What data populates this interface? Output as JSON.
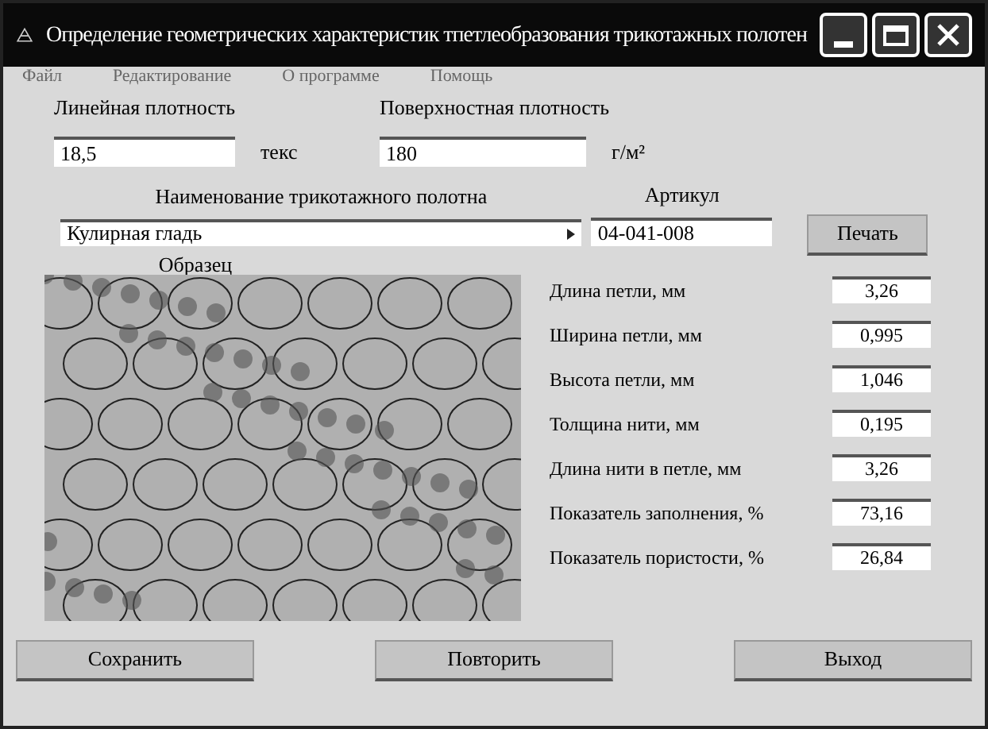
{
  "window": {
    "title": "Определение геометрических характеристик тпетлеобразования трикотажных полотен"
  },
  "menu": [
    "Файл",
    "Редактирование",
    "О программе",
    "Помощь"
  ],
  "linear_density": {
    "label": "Линейная  плотность",
    "value": "18,5",
    "unit": "текс"
  },
  "surface_density": {
    "label": "Поверхностная плотность",
    "value": "180",
    "unit": "г/м²"
  },
  "fabric_name": {
    "label": "Наименование трикотажного полотна",
    "value": "Кулирная гладь"
  },
  "article": {
    "label": "Артикул",
    "value": "04-041-008"
  },
  "print_button": "Печать",
  "sample": {
    "label": "Образец"
  },
  "results": [
    {
      "label": "Длина петли, мм",
      "value": "3,26"
    },
    {
      "label": "Ширина петли, мм",
      "value": "0,995"
    },
    {
      "label": "Высота петли, мм",
      "value": "1,046"
    },
    {
      "label": "Толщина нити, мм",
      "value": "0,195"
    },
    {
      "label": "Длина нити в петле, мм",
      "value": "3,26"
    },
    {
      "label": "Показатель заполнения, %",
      "value": "73,16"
    },
    {
      "label": "Показатель пористости, %",
      "value": "26,84"
    }
  ],
  "buttons": [
    "Сохранить",
    "Повторить",
    "Выход"
  ]
}
